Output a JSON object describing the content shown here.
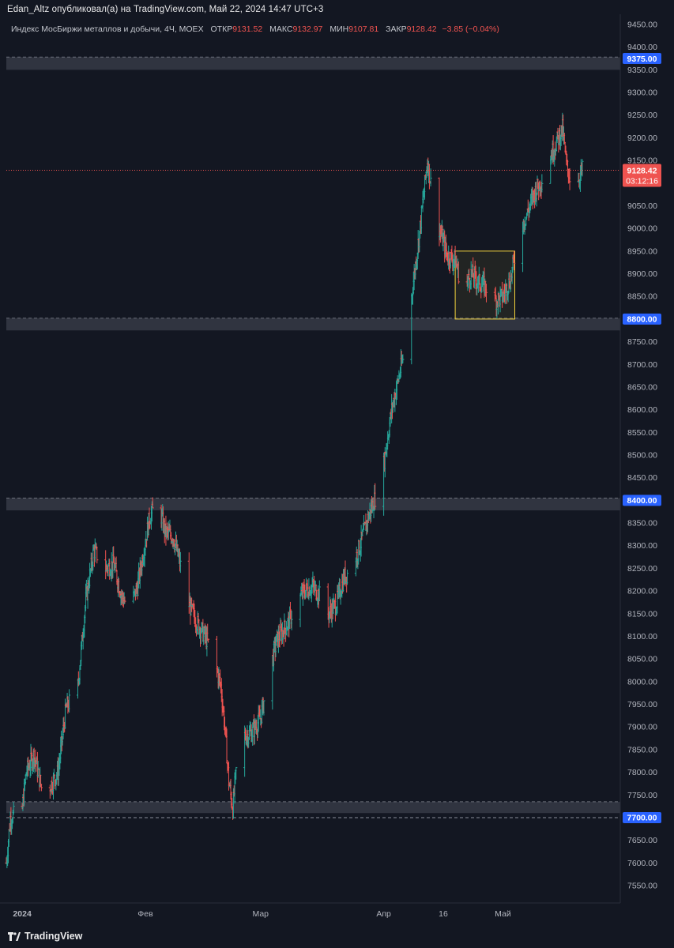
{
  "header": {
    "published": "Edan_Altz опубликовал(а) на TradingView.com, Май 22, 2024 14:47 UTC+3"
  },
  "legend": {
    "symbol": "Индекс МосБиржи металлов и добычи, 4Ч, MOEX",
    "open_label": "ОТКР",
    "open": "9131.52",
    "high_label": "МАКС",
    "high": "9132.97",
    "low_label": "МИН",
    "low": "9107.81",
    "close_label": "ЗАКР",
    "close": "9128.42",
    "change": "−3.85 (−0.04%)"
  },
  "footer": {
    "brand": "TradingView"
  },
  "colors": {
    "background": "#131722",
    "up": "#26a69a",
    "down": "#ef5350",
    "zone": "#363a45",
    "box": "#f2d23c",
    "label_blue": "#2962ff",
    "grid_text": "#b2b5be"
  },
  "chart_data": {
    "type": "ohlc",
    "title": "Индекс МосБиржи металлов и добычи, 4Ч, MOEX",
    "ylim": [
      7515,
      9480
    ],
    "y_ticks": [
      9450,
      9400,
      9350,
      9300,
      9250,
      9200,
      9150,
      9100,
      9050,
      9000,
      8950,
      8900,
      8850,
      8800,
      8750,
      8700,
      8650,
      8600,
      8550,
      8500,
      8450,
      8400,
      8350,
      8300,
      8250,
      8200,
      8150,
      8100,
      8050,
      8000,
      7950,
      7900,
      7850,
      7800,
      7750,
      7700,
      7650,
      7600,
      7550
    ],
    "x_labels": [
      "2024",
      "Фев",
      "Мар",
      "Апр",
      "16",
      "Май"
    ],
    "x_label_dates": [
      "2024-01-01",
      "2024-02-01",
      "2024-03-01",
      "2024-04-01",
      "2024-04-16",
      "2024-05-01"
    ],
    "x_range": [
      "2023-12-28",
      "2024-05-22"
    ],
    "price_labels": [
      {
        "value": 9375.0,
        "text": "9375.00"
      },
      {
        "value": 8800.0,
        "text": "8800.00"
      },
      {
        "value": 8400.0,
        "text": "8400.00"
      },
      {
        "value": 7700.0,
        "text": "7700.00"
      }
    ],
    "last_price": {
      "value": 9128.42,
      "text": "9128.42",
      "countdown": "03:12:16"
    },
    "support_resistance_zones": [
      {
        "from": 9350,
        "to": 9378
      },
      {
        "from": 8775,
        "to": 8802
      },
      {
        "from": 8378,
        "to": 8405
      },
      {
        "from": 7710,
        "to": 7735
      }
    ],
    "dashed_level": 7700,
    "consolidation_box": {
      "from_date": "2024-04-19",
      "to_date": "2024-05-04",
      "low": 8800,
      "high": 8950
    },
    "path": [
      [
        "2023-12-28",
        7600
      ],
      [
        "2023-12-29",
        7700
      ],
      [
        "2024-01-01",
        7720
      ],
      [
        "2024-01-02",
        7800
      ],
      [
        "2024-01-04",
        7840
      ],
      [
        "2024-01-06",
        7760
      ],
      [
        "2024-01-08",
        7770
      ],
      [
        "2024-01-10",
        7800
      ],
      [
        "2024-01-12",
        7940
      ],
      [
        "2024-01-15",
        7990
      ],
      [
        "2024-01-17",
        8180
      ],
      [
        "2024-01-19",
        8290
      ],
      [
        "2024-01-22",
        8250
      ],
      [
        "2024-01-24",
        8260
      ],
      [
        "2024-01-26",
        8190
      ],
      [
        "2024-01-28",
        8160
      ],
      [
        "2024-01-30",
        8210
      ],
      [
        "2024-02-02",
        8360
      ],
      [
        "2024-02-04",
        8400
      ],
      [
        "2024-02-06",
        8330
      ],
      [
        "2024-02-08",
        8320
      ],
      [
        "2024-02-10",
        8250
      ],
      [
        "2024-02-12",
        8170
      ],
      [
        "2024-02-14",
        8130
      ],
      [
        "2024-02-16",
        8100
      ],
      [
        "2024-02-18",
        8060
      ],
      [
        "2024-02-20",
        7990
      ],
      [
        "2024-02-21",
        7900
      ],
      [
        "2024-02-22",
        7780
      ],
      [
        "2024-02-23",
        7720
      ],
      [
        "2024-02-24",
        7820
      ],
      [
        "2024-02-26",
        7880
      ],
      [
        "2024-02-28",
        7890
      ],
      [
        "2024-03-01",
        7920
      ],
      [
        "2024-03-03",
        8010
      ],
      [
        "2024-03-05",
        8090
      ],
      [
        "2024-03-08",
        8130
      ],
      [
        "2024-03-10",
        8170
      ],
      [
        "2024-03-12",
        8200
      ],
      [
        "2024-03-14",
        8210
      ],
      [
        "2024-03-16",
        8190
      ],
      [
        "2024-03-18",
        8150
      ],
      [
        "2024-03-20",
        8170
      ],
      [
        "2024-03-22",
        8230
      ],
      [
        "2024-03-24",
        8250
      ],
      [
        "2024-03-26",
        8300
      ],
      [
        "2024-03-28",
        8360
      ],
      [
        "2024-03-30",
        8410
      ],
      [
        "2024-04-01",
        8480
      ],
      [
        "2024-04-03",
        8600
      ],
      [
        "2024-04-05",
        8680
      ],
      [
        "2024-04-07",
        8760
      ],
      [
        "2024-04-08",
        8850
      ],
      [
        "2024-04-10",
        8990
      ],
      [
        "2024-04-11",
        9070
      ],
      [
        "2024-04-12",
        9150
      ],
      [
        "2024-04-13",
        9090
      ],
      [
        "2024-04-15",
        9000
      ],
      [
        "2024-04-17",
        8940
      ],
      [
        "2024-04-19",
        8930
      ],
      [
        "2024-04-21",
        8860
      ],
      [
        "2024-04-23",
        8900
      ],
      [
        "2024-04-25",
        8880
      ],
      [
        "2024-04-27",
        8870
      ],
      [
        "2024-04-29",
        8840
      ],
      [
        "2024-05-01",
        8850
      ],
      [
        "2024-05-03",
        8890
      ],
      [
        "2024-05-05",
        8990
      ],
      [
        "2024-05-07",
        9030
      ],
      [
        "2024-05-09",
        9080
      ],
      [
        "2024-05-11",
        9110
      ],
      [
        "2024-05-13",
        9160
      ],
      [
        "2024-05-15",
        9200
      ],
      [
        "2024-05-16",
        9220
      ],
      [
        "2024-05-17",
        9140
      ],
      [
        "2024-05-19",
        9080
      ],
      [
        "2024-05-20",
        9110
      ],
      [
        "2024-05-21",
        9130
      ]
    ]
  }
}
